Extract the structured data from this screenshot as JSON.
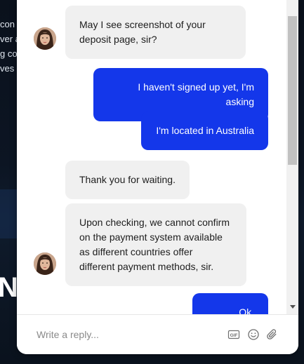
{
  "background_page": {
    "text_lines": [
      "con",
      "ver a",
      "g co",
      "ves"
    ],
    "hero_text": "Ni"
  },
  "chat": {
    "messages": [
      {
        "from": "agent",
        "lines": [
          "May I see screenshot of your",
          "deposit page, sir?"
        ]
      },
      {
        "from": "user",
        "lines": [
          "I haven't signed up yet, I'm asking"
        ]
      },
      {
        "from": "user",
        "lines": [
          "I'm located in Australia"
        ]
      },
      {
        "from": "agent",
        "lines": [
          "Thank you for waiting."
        ]
      },
      {
        "from": "agent",
        "lines": [
          "Upon checking, we cannot confirm",
          "on the payment system available",
          "as different countries offer",
          "different payment methods, sir."
        ]
      },
      {
        "from": "user",
        "lines": [
          "Ok, thanks."
        ]
      }
    ]
  },
  "composer": {
    "placeholder": "Write a reply...",
    "gif_label": "GIF",
    "icons": [
      "gif-icon",
      "emoji-icon",
      "paperclip-icon"
    ]
  },
  "colors": {
    "user_bubble": "#1437ea",
    "agent_bubble": "#f0f0f0",
    "background": "#0d1624"
  }
}
